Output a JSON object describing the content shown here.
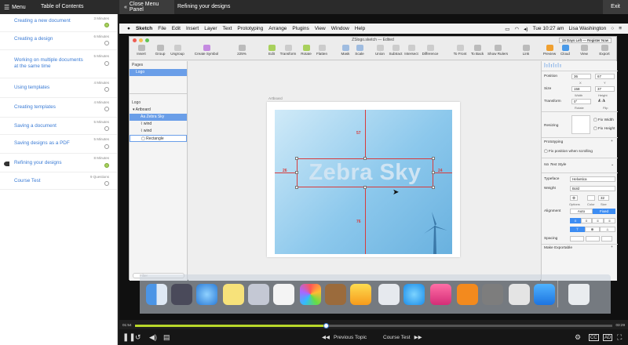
{
  "topbar": {
    "menu_icon": "hamburger-icon",
    "menu_label": "Menu",
    "toc_title": "Table of Contents",
    "close_icon": "chevrons-left-icon",
    "close_label": "Close Menu Panel",
    "lesson_title": "Refining your designs",
    "exit_label": "Exit"
  },
  "toc": [
    {
      "label": "Creating a new document",
      "meta": "3 Minutes",
      "status": "complete"
    },
    {
      "label": "Creating a design",
      "meta": "6 Minutes",
      "status": "incomplete"
    },
    {
      "label": "Working on multiple documents at the same time",
      "meta": "5 Minutes",
      "status": "incomplete"
    },
    {
      "label": "Using templates",
      "meta": "4 Minutes",
      "status": "incomplete"
    },
    {
      "label": "Creating templates",
      "meta": "4 Minutes",
      "status": "incomplete"
    },
    {
      "label": "Saving a document",
      "meta": "5 Minutes",
      "status": "incomplete"
    },
    {
      "label": "Saving designs as a PDF",
      "meta": "5 Minutes",
      "status": "incomplete"
    },
    {
      "label": "Refining your designs",
      "meta": "8 Minutes",
      "status": "current"
    },
    {
      "label": "Course Test",
      "meta": "9 Questions",
      "status": "incomplete"
    }
  ],
  "mac": {
    "apple_icon": "apple-icon",
    "menus": [
      "Sketch",
      "File",
      "Edit",
      "Insert",
      "Layer",
      "Text",
      "Prototyping",
      "Arrange",
      "Plugins",
      "View",
      "Window",
      "Help"
    ],
    "clock": "Tue 10:27 am",
    "user": "Lisa Washington"
  },
  "sketch": {
    "doc_title": "ZSlogo.sketch — Edited",
    "trial_badge": "19 Days Left — Register Now",
    "toolbar": [
      "Insert",
      "Group",
      "Ungroup",
      "Create Symbol",
      "225%",
      "Edit",
      "Transform",
      "Rotate",
      "Flatten",
      "Mask",
      "Scale",
      "Union",
      "Subtract",
      "Intersect",
      "Difference",
      "To Front",
      "To Back",
      "Show Rulers",
      "Link",
      "Preview",
      "Cloud",
      "View",
      "Export"
    ],
    "pages_header": "Pages",
    "page_selected": "Logo",
    "layers_header": "Logo",
    "layers": [
      {
        "label": "Artboard",
        "selected": false
      },
      {
        "label": "Aa  Zebra Sky",
        "selected": true
      },
      {
        "label": "wind",
        "selected": false
      },
      {
        "label": "wind",
        "selected": false
      },
      {
        "label": "Rectangle",
        "selected": false
      }
    ],
    "filter_placeholder": "Filter",
    "artboard_label": "Artboard",
    "logo_text": "Zebra Sky",
    "guides": {
      "top": "57",
      "bottom": "76",
      "left": "26",
      "right": "24"
    }
  },
  "inspector": {
    "position_label": "Position",
    "x": "36",
    "y": "67",
    "x_cap": "X",
    "y_cap": "Y",
    "size_label": "Size",
    "width": "158",
    "height": "37",
    "width_cap": "Width",
    "height_cap": "Height",
    "transform_label": "Transform",
    "rotate": "0°",
    "rotate_cap": "Rotate",
    "flip_cap": "Flip",
    "resizing_label": "Resizing",
    "fix_width": "Fix Width",
    "fix_height": "Fix Height",
    "prototyping_label": "Prototyping",
    "fix_scroll": "Fix position when scrolling",
    "text_style": "No Text Style",
    "typeface_label": "Typeface",
    "typeface": "Helvetica",
    "weight_label": "Weight",
    "weight": "Bold",
    "options_cap": "Options",
    "color_cap": "Color",
    "font_size": "32",
    "size_cap": "Size",
    "alignment_label": "Alignment",
    "auto": "Auto",
    "fixed": "Fixed",
    "spacing_label": "Spacing",
    "make_exportable": "Make Exportable"
  },
  "player": {
    "time_elapsed": "01:54",
    "time_total": "03:29",
    "progress": 0.4,
    "prev_label": "Previous Topic",
    "next_label": "Course Test"
  }
}
